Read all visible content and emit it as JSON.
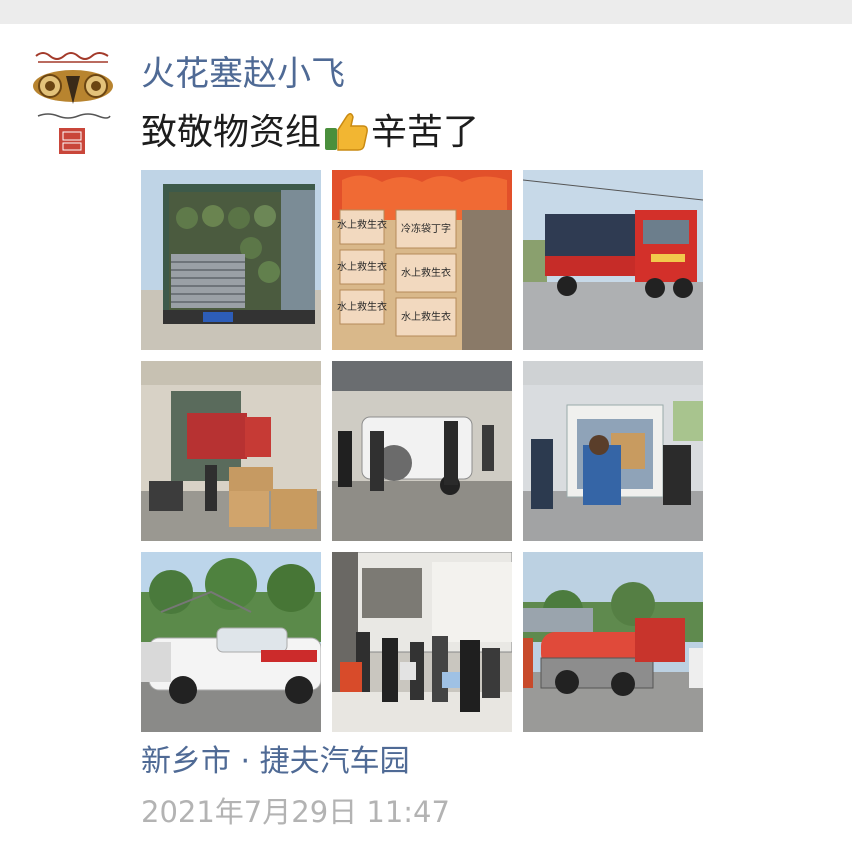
{
  "post": {
    "author": "火花塞赵小飞",
    "text_before_emoji": "致敬物资组",
    "emoji": "thumbs-up",
    "text_after_emoji": "辛苦了",
    "location": "新乡市 · 捷夫汽车园",
    "timestamp": "2021年7月29日 11:47"
  },
  "photos": [
    {
      "subject": "truck-cargo-open"
    },
    {
      "subject": "boxes-life-jackets",
      "labels": [
        "水上救生衣",
        "水上救生衣",
        "水上救生衣",
        "冷冻袋丁字",
        "水上救生衣",
        "水上救生衣"
      ]
    },
    {
      "subject": "red-truck"
    },
    {
      "subject": "warehouse-boxes"
    },
    {
      "subject": "white-suv-loading"
    },
    {
      "subject": "van-loading"
    },
    {
      "subject": "white-suv-outdoor"
    },
    {
      "subject": "truck-volunteers"
    },
    {
      "subject": "rescue-boat-trailer"
    }
  ],
  "colors": {
    "link": "#4f6a95",
    "text": "#1d1d1d",
    "timestamp": "#b3b3b3",
    "topbar": "#ececec"
  }
}
